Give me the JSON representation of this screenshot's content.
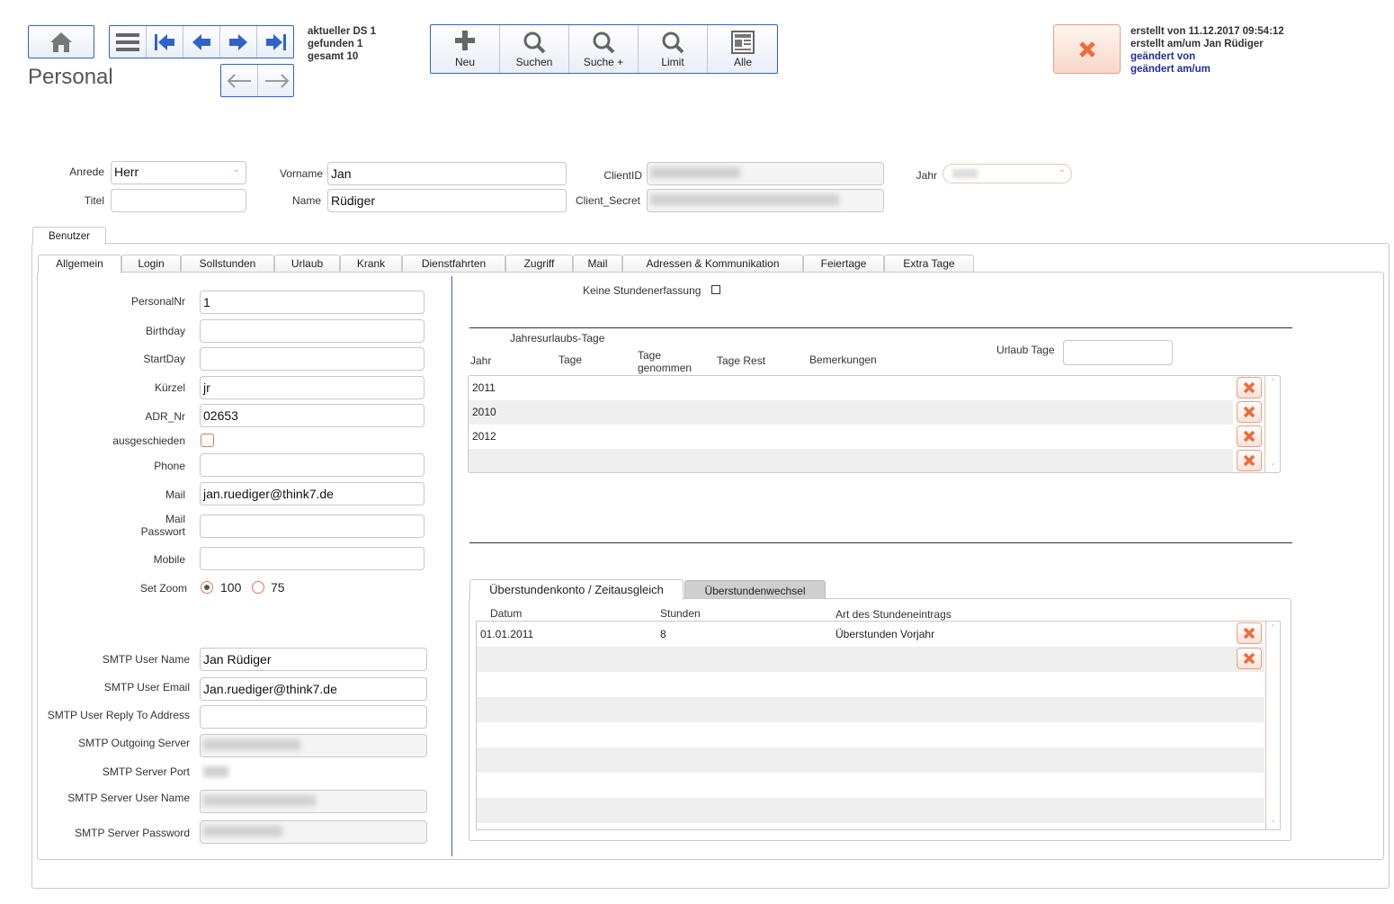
{
  "header": {
    "title": "Personal",
    "record_info": [
      "aktueller DS 1",
      "gefunden 1",
      "gesamt 10"
    ],
    "toolbar": [
      {
        "label": "Neu",
        "icon": "plus-icon"
      },
      {
        "label": "Suchen",
        "icon": "search-icon"
      },
      {
        "label": "Suche +",
        "icon": "search-plus-icon"
      },
      {
        "label": "Limit",
        "icon": "limit-search-icon"
      },
      {
        "label": "Alle",
        "icon": "all-records-icon"
      }
    ],
    "meta": {
      "created": "erstellt von 11.12.2017 09:54:12",
      "created_by": "erstellt am/um Jan Rüdiger",
      "changed_by": "geändert von",
      "changed_at": "geändert am/um"
    }
  },
  "top_form": {
    "anrede_label": "Anrede",
    "anrede_value": "Herr",
    "titel_label": "Titel",
    "titel_value": "",
    "vorname_label": "Vorname",
    "vorname_value": "Jan",
    "name_label": "Name",
    "name_value": "Rüdiger",
    "clientid_label": "ClientID",
    "clientid_value": "",
    "client_secret_label": "Client_Secret",
    "client_secret_value": "",
    "jahr_label": "Jahr",
    "jahr_value": ""
  },
  "outer_tab": "Benutzer",
  "tabs": [
    "Allgemein",
    "Login",
    "Sollstunden",
    "Urlaub",
    "Krank",
    "Dienstfahrten",
    "Zugriff",
    "Mail",
    "Adressen & Kommunikation",
    "Feiertage",
    "Extra Tage"
  ],
  "left_form": {
    "personalnr_label": "PersonalNr",
    "personalnr_value": "1",
    "birthday_label": "Birthday",
    "birthday_value": "",
    "startday_label": "StartDay",
    "startday_value": "",
    "kuerzel_label": "Kürzel",
    "kuerzel_value": "jr",
    "adr_nr_label": "ADR_Nr",
    "adr_nr_value": "02653",
    "ausgeschieden_label": "ausgeschieden",
    "phone_label": "Phone",
    "phone_value": "",
    "mail_label": "Mail",
    "mail_value": "jan.ruediger@think7.de",
    "mail_pw_label_1": "Mail",
    "mail_pw_label_2": "Passwort",
    "mail_pw_value": "",
    "mobile_label": "Mobile",
    "mobile_value": "",
    "zoom_label": "Set Zoom",
    "zoom_opt1": "100",
    "zoom_opt2": "75",
    "smtp_user_name_label": "SMTP User Name",
    "smtp_user_name_value": "Jan Rüdiger",
    "smtp_user_email_label": "SMTP User Email",
    "smtp_user_email_value": "Jan.ruediger@think7.de",
    "smtp_reply_label": "SMTP User Reply To Address",
    "smtp_reply_value": "",
    "smtp_outgoing_label": "SMTP Outgoing Server",
    "smtp_outgoing_value": "",
    "smtp_port_label": "SMTP Server Port",
    "smtp_port_value": "",
    "smtp_server_user_label": "SMTP Server User Name",
    "smtp_server_user_value": "",
    "smtp_server_pw_label": "SMTP Server Password",
    "smtp_server_pw_value": ""
  },
  "right_panel": {
    "keine_label": "Keine Stundenerfassung",
    "jahresurlaub_label": "Jahresurlaubs-Tage",
    "col_jahr": "Jahr",
    "col_tage": "Tage",
    "col_genommen_1": "Tage",
    "col_genommen_2": "genommen",
    "col_rest": "Tage Rest",
    "col_bem": "Bemerkungen",
    "urlaub_tage_label": "Urlaub Tage",
    "urlaub_tage_value": "",
    "urlaub_rows": [
      "2011",
      "2010",
      "2012",
      ""
    ],
    "subtab_1": "Überstundenkonto / Zeitausgleich",
    "subtab_2": "Überstundenwechsel",
    "ot_col_datum": "Datum",
    "ot_col_stunden": "Stunden",
    "ot_col_art": "Art des Stundeneintrags",
    "ot_rows": [
      {
        "datum": "01.01.2011",
        "stunden": "8",
        "art": "Überstunden Vorjahr"
      }
    ]
  },
  "colors": {
    "accent": "#2f63c8",
    "delete": "#f06a3a",
    "meta_blue": "#1f2fa0"
  }
}
